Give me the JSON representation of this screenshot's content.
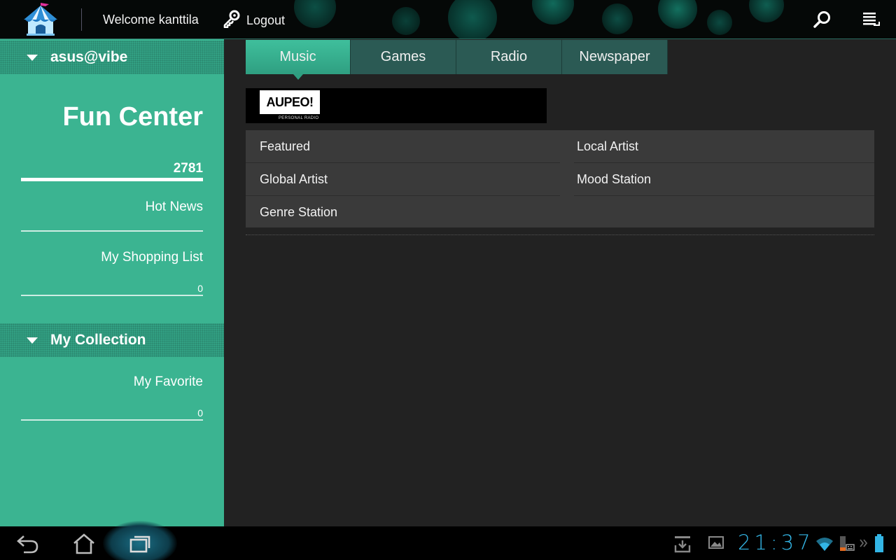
{
  "topbar": {
    "welcome_text": "Welcome kanttila",
    "logout_label": "Logout",
    "icons": {
      "logo": "tent-icon",
      "logout": "key-icon",
      "search": "search-icon",
      "menu": "overflow-menu-icon"
    }
  },
  "sidebar": {
    "account_header": "asus@vibe",
    "title": "Fun Center",
    "points": "2781",
    "hot_news_label": "Hot News",
    "shopping_list": {
      "label": "My Shopping List",
      "count": "0"
    },
    "collection_header": "My Collection",
    "favorite": {
      "label": "My Favorite",
      "count": "0"
    }
  },
  "main": {
    "tabs": [
      {
        "label": "Music",
        "active": true
      },
      {
        "label": "Games",
        "active": false
      },
      {
        "label": "Radio",
        "active": false
      },
      {
        "label": "Newspaper",
        "active": false
      }
    ],
    "banner": {
      "brand": "AUPEO!",
      "tagline": "PERSONAL RADIO"
    },
    "categories": {
      "left": [
        "Featured",
        "Global Artist",
        "Genre Station"
      ],
      "right": [
        "Local Artist",
        "Mood Station"
      ]
    }
  },
  "system_bar": {
    "clock": "21:37",
    "icons": [
      "back-icon",
      "home-icon",
      "recent-apps-icon",
      "download-icon",
      "gallery-icon",
      "wifi-icon",
      "keyboard-icon",
      "battery-icon"
    ]
  },
  "colors": {
    "sidebar_bg": "#3bb491",
    "tab_active": "#35ac8b",
    "tab_inactive": "#2b5a54",
    "main_bg": "#222222",
    "clock": "#33b5e5"
  }
}
